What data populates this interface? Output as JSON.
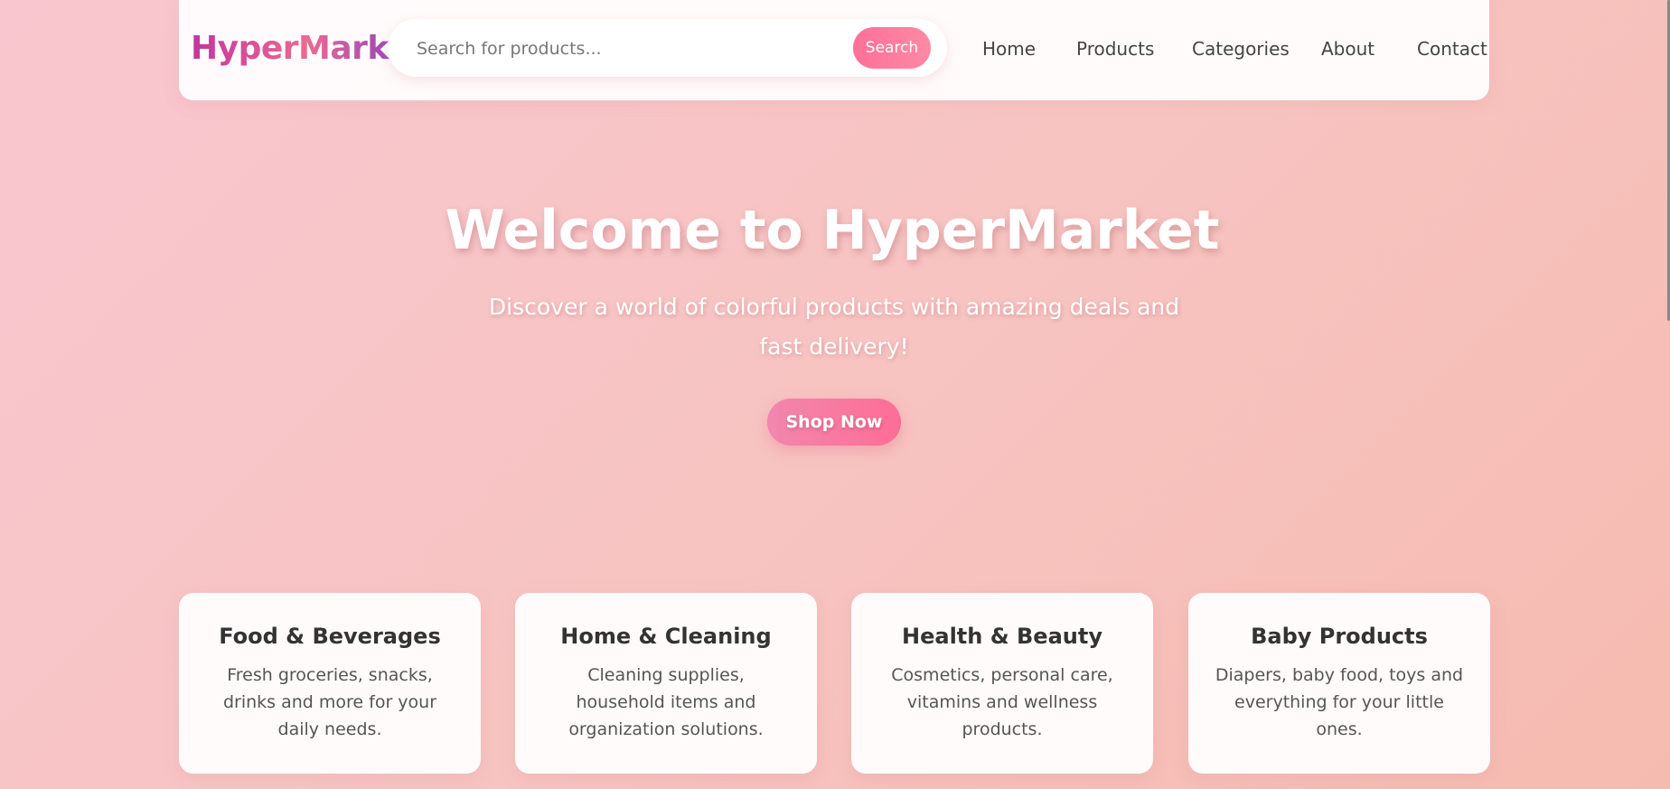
{
  "header": {
    "logo": "HyperMarket",
    "search": {
      "placeholder": "Search for products...",
      "value": "",
      "button_label": "Search"
    },
    "nav": {
      "home": "Home",
      "products": "Products",
      "categories": "Categories",
      "about": "About",
      "contact": "Contact"
    }
  },
  "hero": {
    "title": "Welcome to HyperMarket",
    "subtitle": "Discover a world of colorful products with amazing deals and fast delivery!",
    "cta_label": "Shop Now"
  },
  "categories": [
    {
      "title": "Food & Beverages",
      "description": "Fresh groceries, snacks, drinks and more for your daily needs."
    },
    {
      "title": "Home & Cleaning",
      "description": "Cleaning supplies, household items and organization solutions."
    },
    {
      "title": "Health & Beauty",
      "description": "Cosmetics, personal care, vitamins and wellness products."
    },
    {
      "title": "Baby Products",
      "description": "Diapers, baby food, toys and everything for your little ones."
    }
  ],
  "colors": {
    "accent": "#ff6f99",
    "background_start": "#f9c6cf",
    "background_end": "#f6bbb0",
    "logo_gradient": [
      "#c2369e",
      "#ec6a92",
      "#7a39c6"
    ]
  }
}
